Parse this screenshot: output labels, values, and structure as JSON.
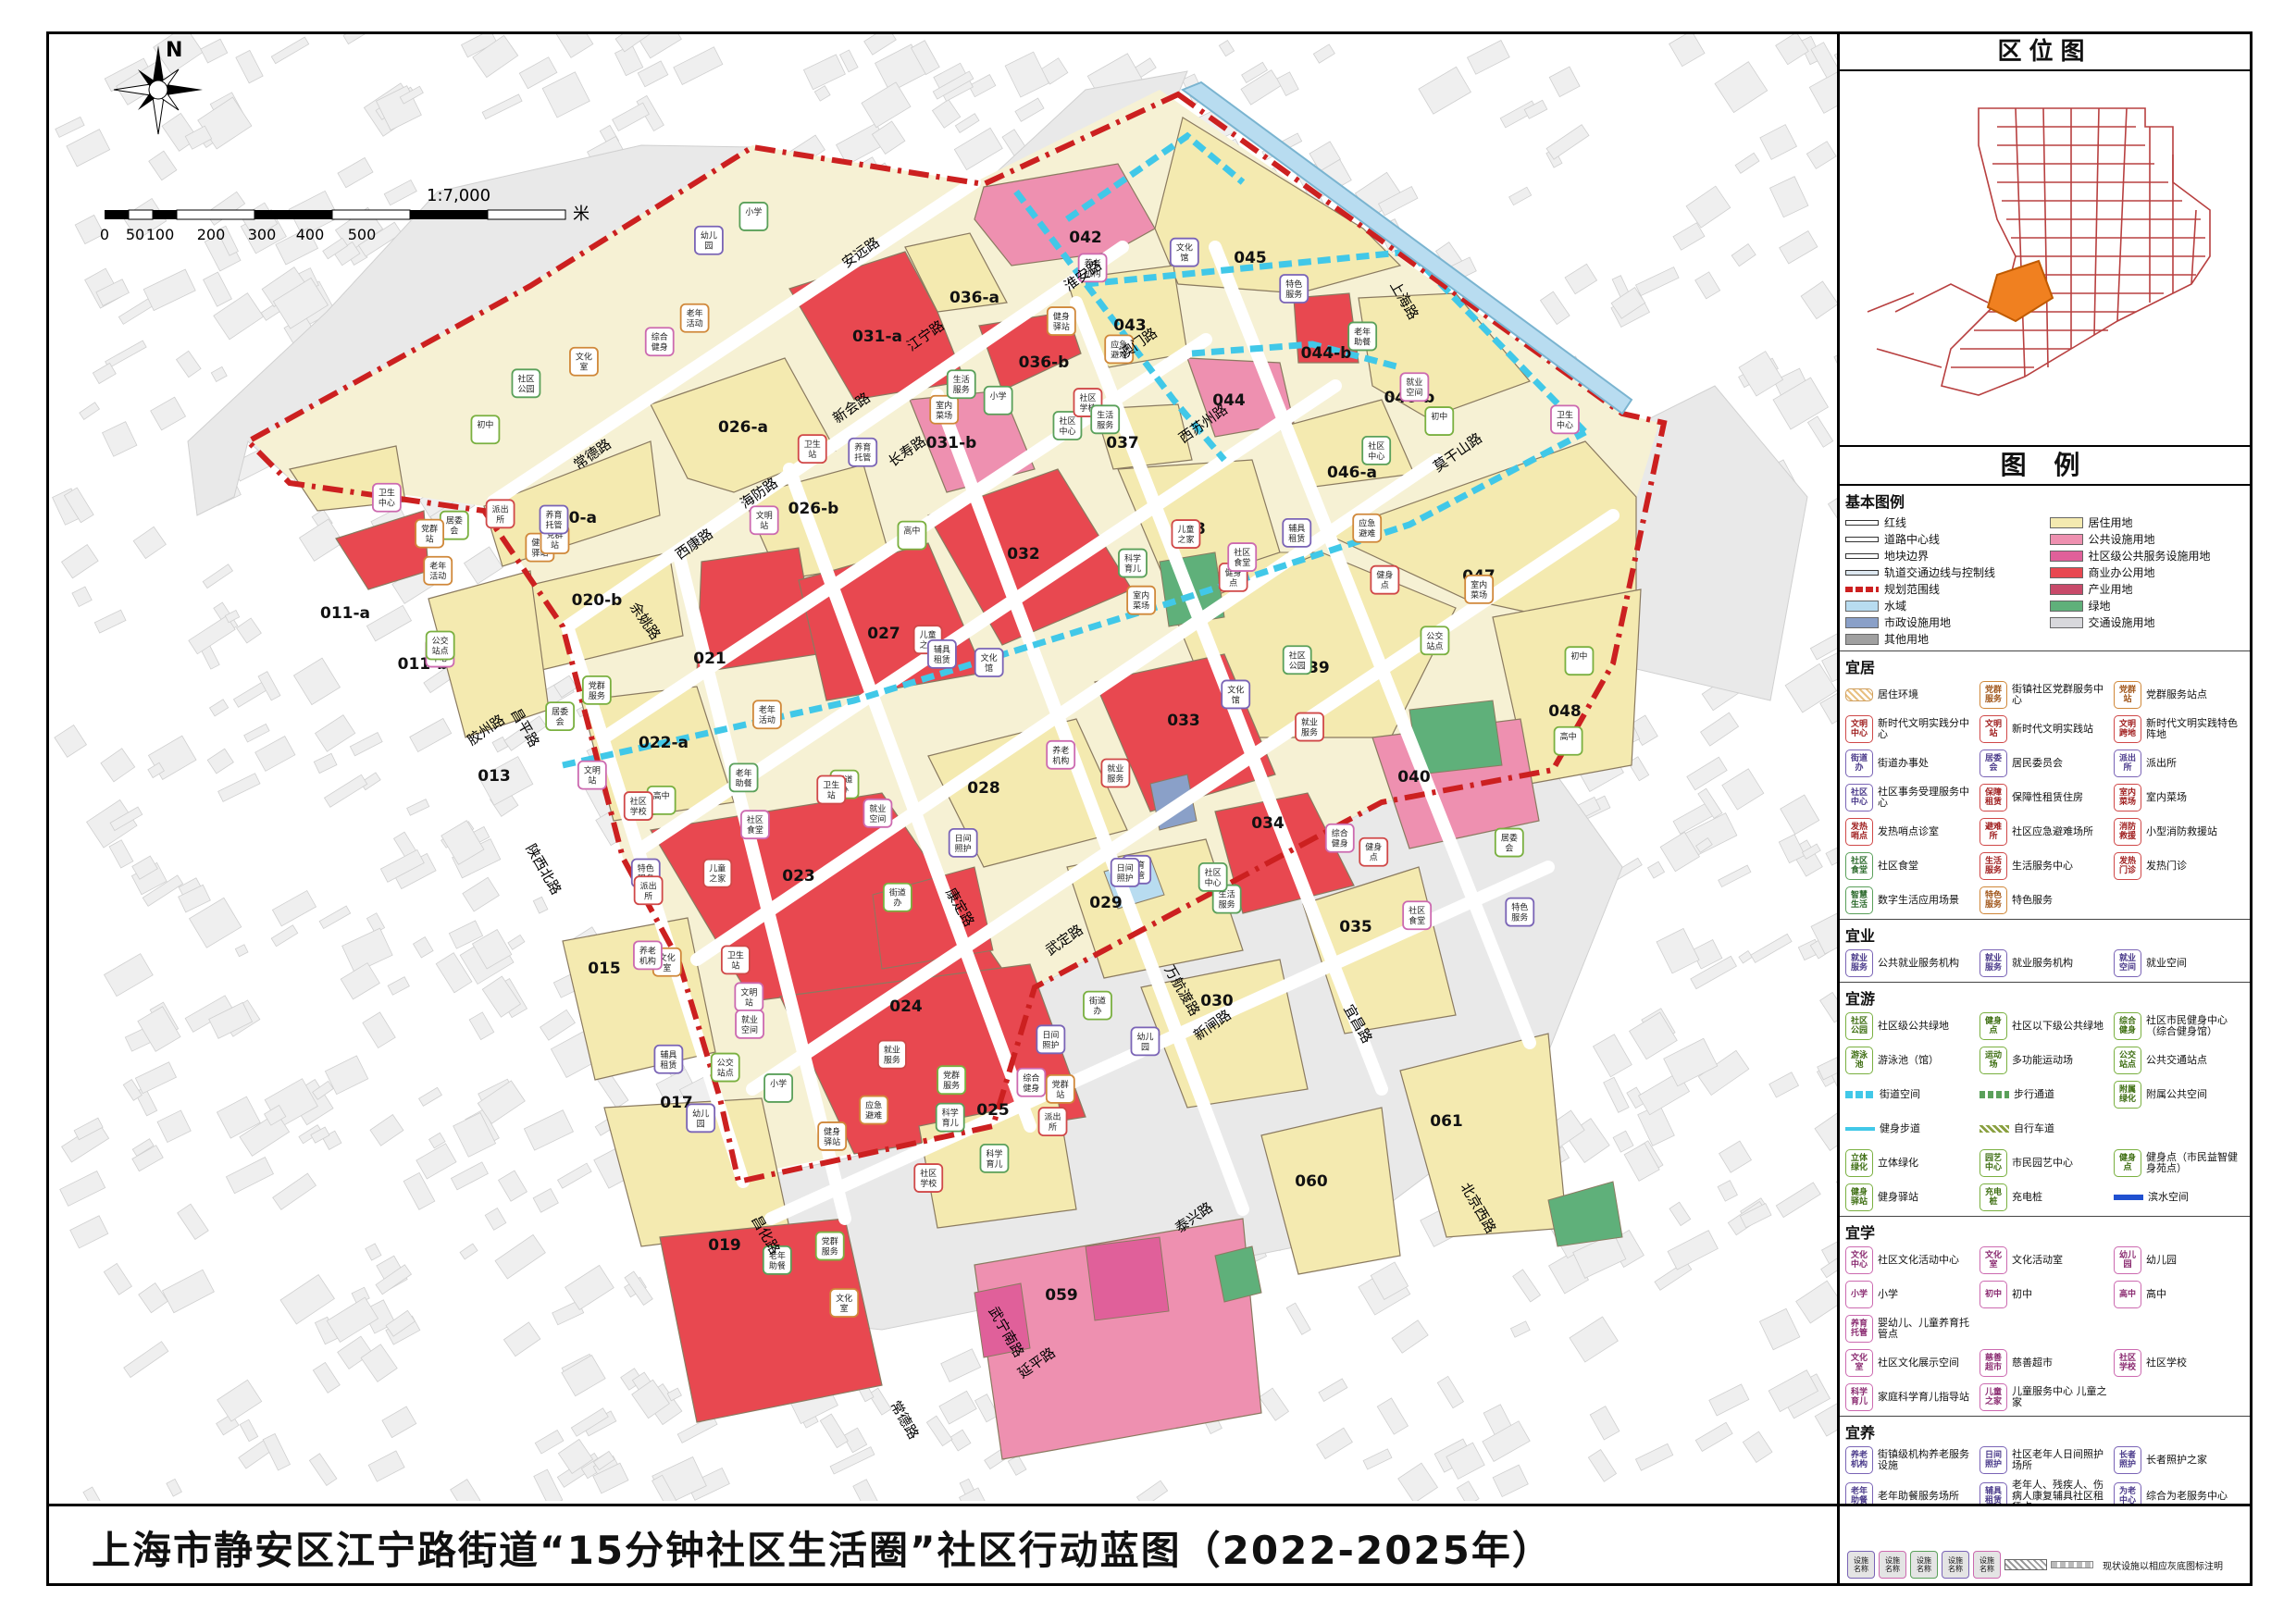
{
  "title": "上海市静安区江宁路街道“15分钟社区生活圈”社区行动蓝图（2022-2025年）",
  "compass": {
    "label": "N"
  },
  "scale": {
    "ratio": "1:7,000",
    "ticks": [
      "0",
      "50",
      "100",
      "200",
      "300",
      "400",
      "500"
    ],
    "unit": "米"
  },
  "locator": {
    "heading": "区位图"
  },
  "legend": {
    "heading": "图  例",
    "base_title": "基本图例",
    "base_items": [
      {
        "label": "红线",
        "color": "#ffffff",
        "style": "line"
      },
      {
        "label": "居住用地",
        "color": "#f4eab0",
        "style": "fill"
      },
      {
        "label": "道路中心线",
        "color": "#ffffff",
        "style": "line"
      },
      {
        "label": "公共设施用地",
        "color": "#ee90b0",
        "style": "fill"
      },
      {
        "label": "地块边界",
        "color": "#ffffff",
        "style": "line"
      },
      {
        "label": "社区级公共服务设施用地",
        "color": "#e0609a",
        "style": "fill"
      },
      {
        "label": "轨道交通边线与控制线",
        "color": "#dde8f0",
        "style": "line"
      },
      {
        "label": "商业办公用地",
        "color": "#e84850",
        "style": "fill"
      },
      {
        "label": "规划范围线",
        "color": "#cc2020",
        "style": "dash"
      },
      {
        "label": "产业用地",
        "color": "#c84a6a",
        "style": "fill"
      },
      {
        "label": "水域",
        "color": "#b8dcf0",
        "style": "fill"
      },
      {
        "label": "绿地",
        "color": "#5fb07a",
        "style": "fill"
      },
      {
        "label": "市政设施用地",
        "color": "#8aa0c8",
        "style": "fill"
      },
      {
        "label": "交通设施用地",
        "color": "#d8d8dc",
        "style": "fill"
      },
      {
        "label": "其他用地",
        "color": "#a0a0a0",
        "style": "fill"
      }
    ],
    "sections": [
      {
        "title": "宜居",
        "items": [
          {
            "icon": "",
            "label": "居住环境",
            "color": "hatch"
          },
          {
            "icon": "党群\n服务",
            "label": "街镇社区党群服务中心",
            "color": "orange"
          },
          {
            "icon": "党群\n站",
            "label": "党群服务站点",
            "color": "orange"
          },
          {
            "icon": "文明\n中心",
            "label": "新时代文明实践分中心",
            "color": "red"
          },
          {
            "icon": "文明\n站",
            "label": "新时代文明实践站",
            "color": "red"
          },
          {
            "icon": "文明\n跨地",
            "label": "新时代文明实践特色阵地",
            "color": "red"
          },
          {
            "icon": "街道\n办",
            "label": "街道办事处",
            "color": "purple"
          },
          {
            "icon": "居委\n会",
            "label": "居民委员会",
            "color": "purple"
          },
          {
            "icon": "派出\n所",
            "label": "派出所",
            "color": "purple"
          },
          {
            "icon": "社区\n中心",
            "label": "社区事务受理服务中心",
            "color": "purple"
          },
          {
            "icon": "保障\n租赁",
            "label": "保障性租赁住房",
            "color": "red"
          },
          {
            "icon": "室内\n菜场",
            "label": "室内菜场",
            "color": "red"
          },
          {
            "icon": "发热\n哨点",
            "label": "发热哨点诊室",
            "color": "red"
          },
          {
            "icon": "避难\n所",
            "label": "社区应急避难场所",
            "color": "red"
          },
          {
            "icon": "消防\n救援",
            "label": "小型消防救援站",
            "color": "red"
          },
          {
            "icon": "社区\n食堂",
            "label": "社区食堂",
            "color": "green"
          },
          {
            "icon": "生活\n服务",
            "label": "生活服务中心",
            "color": "red"
          },
          {
            "icon": "发热\n门诊",
            "label": "发热门诊",
            "color": "red"
          },
          {
            "icon": "智慧\n生活",
            "label": "数字生活应用场景",
            "color": "green"
          },
          {
            "icon": "特色\n服务",
            "label": "特色服务",
            "color": "orange"
          }
        ]
      },
      {
        "title": "宜业",
        "items": [
          {
            "icon": "就业\n服务",
            "label": "公共就业服务机构",
            "color": "purple"
          },
          {
            "icon": "就业\n服务",
            "label": "就业服务机构",
            "color": "purple"
          },
          {
            "icon": "就业\n空间",
            "label": "就业空间",
            "color": "purple"
          }
        ]
      },
      {
        "title": "宜游",
        "items": [
          {
            "icon": "社区\n公园",
            "label": "社区级公共绿地",
            "color": "lime"
          },
          {
            "icon": "健身\n点",
            "label": "社区以下级公共绿地",
            "color": "lime"
          },
          {
            "icon": "综合\n健身",
            "label": "社区市民健身中心（综合健身馆）",
            "color": "lime"
          },
          {
            "icon": "游泳\n池",
            "label": "游泳池（馆）",
            "color": "lime"
          },
          {
            "icon": "运动\n场",
            "label": "多功能运动场",
            "color": "lime"
          },
          {
            "icon": "公交\n站点",
            "label": "公共交通站点",
            "color": "lime"
          },
          {
            "icon": "",
            "label": "街道空间",
            "color": "line-cyan"
          },
          {
            "icon": "",
            "label": "步行通道",
            "color": "line-green"
          },
          {
            "icon": "附属\n绿化",
            "label": "附属公共空间",
            "color": "lime"
          },
          {
            "icon": "",
            "label": "健身步道",
            "color": "line-cyan2"
          },
          {
            "icon": "",
            "label": "自行车道",
            "color": "line-olive"
          },
          {
            "icon": "",
            "label": "",
            "color": "blank"
          },
          {
            "icon": "立体\n绿化",
            "label": "立体绿化",
            "color": "lime"
          },
          {
            "icon": "园艺\n中心",
            "label": "市民园艺中心",
            "color": "lime"
          },
          {
            "icon": "健身\n点",
            "label": "健身点（市民益智健身苑点）",
            "color": "lime"
          },
          {
            "icon": "健身\n驿站",
            "label": "健身驿站",
            "color": "lime"
          },
          {
            "icon": "充电\n桩",
            "label": "充电桩",
            "color": "lime"
          },
          {
            "icon": "",
            "label": "滨水空间",
            "color": "line-blue"
          }
        ]
      },
      {
        "title": "宜学",
        "items": [
          {
            "icon": "文化\n中心",
            "label": "社区文化活动中心",
            "color": "pink"
          },
          {
            "icon": "文化\n室",
            "label": "文化活动室",
            "color": "pink"
          },
          {
            "icon": "幼儿\n园",
            "label": "幼儿园",
            "color": "pink"
          },
          {
            "icon": "小学",
            "label": "小学",
            "color": "pink"
          },
          {
            "icon": "初中",
            "label": "初中",
            "color": "pink"
          },
          {
            "icon": "高中",
            "label": "高中",
            "color": "pink"
          },
          {
            "icon": "养育\n托管",
            "label": "婴幼儿、儿童养育托管点",
            "color": "pink"
          },
          {
            "icon": "",
            "label": "",
            "color": "blank"
          },
          {
            "icon": "",
            "label": "",
            "color": "blank"
          },
          {
            "icon": "文化\n室",
            "label": "社区文化展示空间",
            "color": "pink"
          },
          {
            "icon": "慈善\n超市",
            "label": "慈善超市",
            "color": "pink"
          },
          {
            "icon": "社区\n学校",
            "label": "社区学校",
            "color": "pink"
          },
          {
            "icon": "科学\n育儿",
            "label": "家庭科学育儿指导站",
            "color": "pink"
          },
          {
            "icon": "儿童\n之家",
            "label": "儿童服务中心 儿童之家",
            "color": "pink"
          }
        ]
      },
      {
        "title": "宜养",
        "items": [
          {
            "icon": "养老\n机构",
            "label": "街镇级机构养老服务设施",
            "color": "purple"
          },
          {
            "icon": "日间\n照护",
            "label": "社区老年人日间照护场所",
            "color": "purple"
          },
          {
            "icon": "长者\n照护",
            "label": "长者照护之家",
            "color": "purple"
          },
          {
            "icon": "老年\n助餐",
            "label": "老年助餐服务场所",
            "color": "purple"
          },
          {
            "icon": "辅具\n租赁",
            "label": "老年人、残疾人、伤病人康复辅具社区租赁点",
            "color": "purple"
          },
          {
            "icon": "为老\n中心",
            "label": "综合为老服务中心",
            "color": "purple"
          },
          {
            "icon": "老年\n活动",
            "label": "老年活动室",
            "color": "purple"
          },
          {
            "icon": "卫生\n中心",
            "label": "社区卫生服务中心",
            "color": "purple"
          },
          {
            "icon": "卫生\n站",
            "label": "卫生服务站",
            "color": "purple"
          },
          {
            "icon": "母婴\n设施",
            "label": "母婴设施",
            "color": "purple"
          },
          {
            "icon": "工疗\n康体",
            "label": "工疗、康体服务中心",
            "color": "purple"
          },
          {
            "icon": "",
            "label": "",
            "color": "blank"
          },
          {
            "icon": "长者\n运动",
            "label": "长者运动健康之家",
            "color": "purple"
          },
          {
            "icon": "健康\n驿站",
            "label": "智慧健康驿站",
            "color": "purple"
          },
          {
            "icon": "未保\n站",
            "label": "未成年人保护工作站",
            "color": "purple"
          },
          {
            "icon": "自留\n地",
            "label": "",
            "color": "purple"
          }
        ]
      }
    ],
    "strip": {
      "icons": [
        "设施\n名称",
        "设施\n名称",
        "设施\n名称",
        "设施\n名称",
        "设施\n名称"
      ],
      "note": "现状设施以相应灰底图标注明"
    }
  },
  "map": {
    "parcels": [
      {
        "id": "042",
        "land": "public"
      },
      {
        "id": "045",
        "land": "residential"
      },
      {
        "id": "036-a",
        "land": "residential"
      },
      {
        "id": "031-a",
        "land": "commercial"
      },
      {
        "id": "043",
        "land": "residential"
      },
      {
        "id": "036-b",
        "land": "commercial"
      },
      {
        "id": "044-b",
        "land": "commercial"
      },
      {
        "id": "046-b",
        "land": "residential"
      },
      {
        "id": "026-a",
        "land": "residential"
      },
      {
        "id": "031-b",
        "land": "public"
      },
      {
        "id": "044",
        "land": "public"
      },
      {
        "id": "037",
        "land": "residential"
      },
      {
        "id": "046-a",
        "land": "residential"
      },
      {
        "id": "020-a",
        "land": "residential"
      },
      {
        "id": "026-b",
        "land": "residential"
      },
      {
        "id": "032",
        "land": "commercial"
      },
      {
        "id": "038",
        "land": "residential"
      },
      {
        "id": "047",
        "land": "residential"
      },
      {
        "id": "011-a",
        "land": "residential"
      },
      {
        "id": "020-b",
        "land": "residential"
      },
      {
        "id": "021",
        "land": "commercial"
      },
      {
        "id": "027",
        "land": "commercial"
      },
      {
        "id": "039",
        "land": "residential"
      },
      {
        "id": "011-b",
        "land": "commercial"
      },
      {
        "id": "022-a",
        "land": "residential"
      },
      {
        "id": "033",
        "land": "commercial"
      },
      {
        "id": "048",
        "land": "residential"
      },
      {
        "id": "013",
        "land": "residential"
      },
      {
        "id": "028",
        "land": "residential"
      },
      {
        "id": "040",
        "land": "public"
      },
      {
        "id": "023",
        "land": "commercial"
      },
      {
        "id": "034",
        "land": "commercial"
      },
      {
        "id": "029",
        "land": "residential"
      },
      {
        "id": "035",
        "land": "residential"
      },
      {
        "id": "015",
        "land": "residential"
      },
      {
        "id": "024",
        "land": "commercial"
      },
      {
        "id": "030",
        "land": "residential"
      },
      {
        "id": "017",
        "land": "residential"
      },
      {
        "id": "025",
        "land": "residential"
      },
      {
        "id": "061",
        "land": "residential"
      },
      {
        "id": "060",
        "land": "residential"
      },
      {
        "id": "019",
        "land": "commercial"
      },
      {
        "id": "059",
        "land": "public"
      }
    ],
    "roads": [
      "安远路",
      "江宁路",
      "新会路",
      "长寿路",
      "常德路",
      "海防路",
      "西康路",
      "余姚路",
      "昌平路",
      "胶州路",
      "陕西北路",
      "康定路",
      "武定路",
      "新闸路",
      "北京西路",
      "泰兴路",
      "延平路",
      "昌化路",
      "宜昌路",
      "万航渡路",
      "莫干山路",
      "西苏州路",
      "澳门路",
      "淮安路",
      "上海路",
      "武宁南路",
      "常德路"
    ],
    "facility_labels": [
      "日间照护",
      "养老机构",
      "健身点",
      "文化室",
      "居委会",
      "老年助餐",
      "文化馆",
      "综合健身",
      "就业服务",
      "室内菜场",
      "初中",
      "小学",
      "幼儿园",
      "卫生中心",
      "卫生站",
      "应急避难",
      "公交站点",
      "生活服务",
      "特色服务",
      "社区食堂",
      "派出所",
      "党群站",
      "高中",
      "科学育儿",
      "养育托管",
      "文明站",
      "儿童之家",
      "老年活动",
      "街道办",
      "社区中心",
      "辅具租赁",
      "就业空间",
      "社区学校",
      "健身驿站",
      "党群服务",
      "社区公园"
    ]
  },
  "colors": {
    "residential": "#f4eab0",
    "commercial": "#e84850",
    "public": "#ee90b0",
    "community": "#e0609a",
    "industry": "#c84a6a",
    "green": "#5fb07a",
    "water": "#b8dcf0",
    "traffic": "#d8d8dc",
    "boundary": "#cc2020",
    "street_space": "#41c8e8",
    "background": "#ececec"
  }
}
